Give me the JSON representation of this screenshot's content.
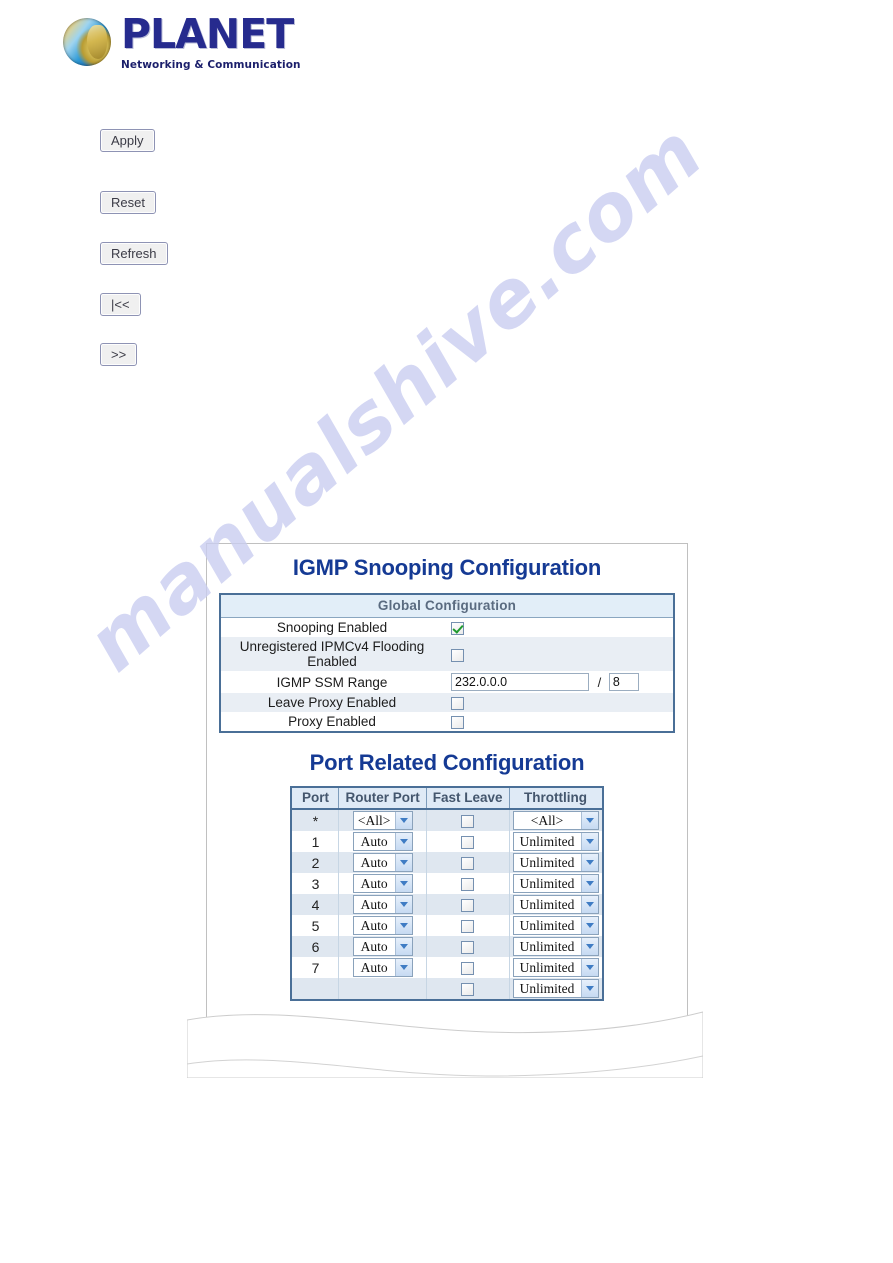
{
  "brand": {
    "logo_icon": "planet-globe-icon",
    "wordmark": "PLANET",
    "tagline": "Networking & Communication"
  },
  "watermark": {
    "text": "manualshive.com",
    "color": "#c9cdf0"
  },
  "buttons": [
    {
      "name": "apply-button",
      "label": "Apply"
    },
    {
      "name": "reset-button",
      "label": "Reset"
    },
    {
      "name": "refresh-button",
      "label": "Refresh"
    },
    {
      "name": "first-page-button",
      "label": "|<<"
    },
    {
      "name": "next-page-button",
      "label": ">>"
    }
  ],
  "screenshot": {
    "title": "IGMP Snooping Configuration",
    "title_color": "#153a94",
    "global": {
      "header": "Global Configuration",
      "rows": [
        {
          "label": "Snooping Enabled",
          "control": "checkbox",
          "checked": true
        },
        {
          "label": "Unregistered IPMCv4 Flooding Enabled",
          "control": "checkbox",
          "checked": false
        },
        {
          "label": "IGMP SSM Range",
          "control": "ip-mask",
          "address": "232.0.0.0",
          "separator": "/",
          "mask": "8"
        },
        {
          "label": "Leave Proxy Enabled",
          "control": "checkbox",
          "checked": false
        },
        {
          "label": "Proxy Enabled",
          "control": "checkbox",
          "checked": false
        }
      ]
    },
    "port_section": {
      "title": "Port Related Configuration",
      "columns": [
        "Port",
        "Router Port",
        "Fast Leave",
        "Throttling"
      ],
      "rows": [
        {
          "port": "*",
          "router_port": "<All>",
          "fast_leave": false,
          "throttling": "<All>"
        },
        {
          "port": "1",
          "router_port": "Auto",
          "fast_leave": false,
          "throttling": "Unlimited"
        },
        {
          "port": "2",
          "router_port": "Auto",
          "fast_leave": false,
          "throttling": "Unlimited"
        },
        {
          "port": "3",
          "router_port": "Auto",
          "fast_leave": false,
          "throttling": "Unlimited"
        },
        {
          "port": "4",
          "router_port": "Auto",
          "fast_leave": false,
          "throttling": "Unlimited"
        },
        {
          "port": "5",
          "router_port": "Auto",
          "fast_leave": false,
          "throttling": "Unlimited"
        },
        {
          "port": "6",
          "router_port": "Auto",
          "fast_leave": false,
          "throttling": "Unlimited"
        },
        {
          "port": "7",
          "router_port": "Auto",
          "fast_leave": false,
          "throttling": "Unlimited"
        },
        {
          "port": "",
          "router_port": "",
          "fast_leave": false,
          "throttling": "Unlimited"
        }
      ]
    }
  }
}
